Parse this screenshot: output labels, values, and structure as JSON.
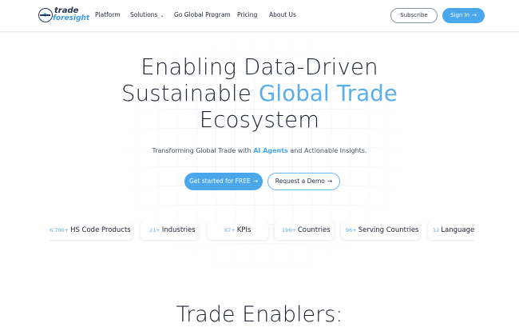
{
  "brand": {
    "logo_top": "trade",
    "logo_bottom": "foresight"
  },
  "nav": {
    "items": [
      {
        "label": "Platform"
      },
      {
        "label": "Solutions"
      },
      {
        "label": "Go Global Program"
      },
      {
        "label": "Pricing"
      },
      {
        "label": "About Us"
      }
    ],
    "subscribe_label": "Subscribe",
    "signin_label": "Sign In",
    "arrow": "→",
    "dropdown": "⌄"
  },
  "hero": {
    "title_line1": "Enabling Data-Driven",
    "title_line2_plain": "Sustainable ",
    "title_line2_accent": "Global Trade",
    "title_line3": "Ecosystem",
    "subtitle_before": "Transforming Global Trade with ",
    "subtitle_accent": "AI Agents",
    "subtitle_after": " and Actionable Insights.",
    "cta_primary": "Get started for FREE",
    "cta_secondary": "Request a Demo"
  },
  "stats": [
    {
      "number": "6,700+",
      "label": "HS Code Products"
    },
    {
      "number": "21+",
      "label": "Industries"
    },
    {
      "number": "67+",
      "label": "KPIs"
    },
    {
      "number": "196+",
      "label": "Countries"
    },
    {
      "number": "96+",
      "label": "Serving Countries"
    },
    {
      "number": "12",
      "label": "Languages"
    }
  ],
  "section": {
    "title": "Trade Enablers:"
  },
  "colors": {
    "accent": "#4aa7ec",
    "text": "#1d2330"
  }
}
